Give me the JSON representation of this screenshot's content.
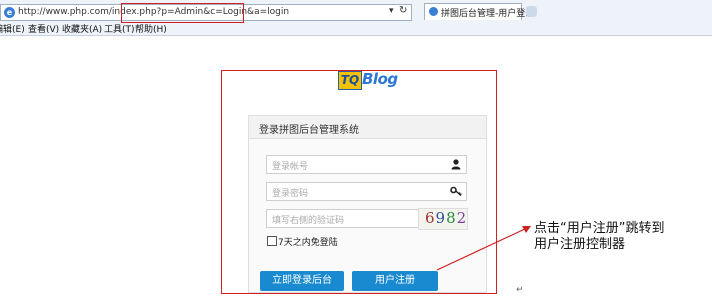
{
  "browser": {
    "url": "http://www.php.com/index.php?p=Admin&c=Login&a=login",
    "tab_title": "拼图后台管理-用户登录",
    "search_arrow": "▾",
    "refresh": "↻"
  },
  "menu": [
    {
      "label": "编辑(E)"
    },
    {
      "label": "查看(V)"
    },
    {
      "label": "收藏夹(A)"
    },
    {
      "label": "工具(T)"
    },
    {
      "label": "帮助(H)"
    }
  ],
  "logo": {
    "prefix": "TQ",
    "suffix": "Blog"
  },
  "panel": {
    "title": "登录拼图后台管理系统",
    "username_placeholder": "登录帐号",
    "password_placeholder": "登录密码",
    "captcha_placeholder": "填写右侧的验证码",
    "captcha_text": "6982",
    "remember_label": "7天之内免登陆",
    "login_button": "立即登录后台",
    "register_button": "用户注册"
  },
  "annotation": {
    "line1": "点击“用户注册”跳转到",
    "line2": "用户注册控制器"
  },
  "colors": {
    "accent": "#1a8ad0",
    "highlight": "#d02020"
  }
}
